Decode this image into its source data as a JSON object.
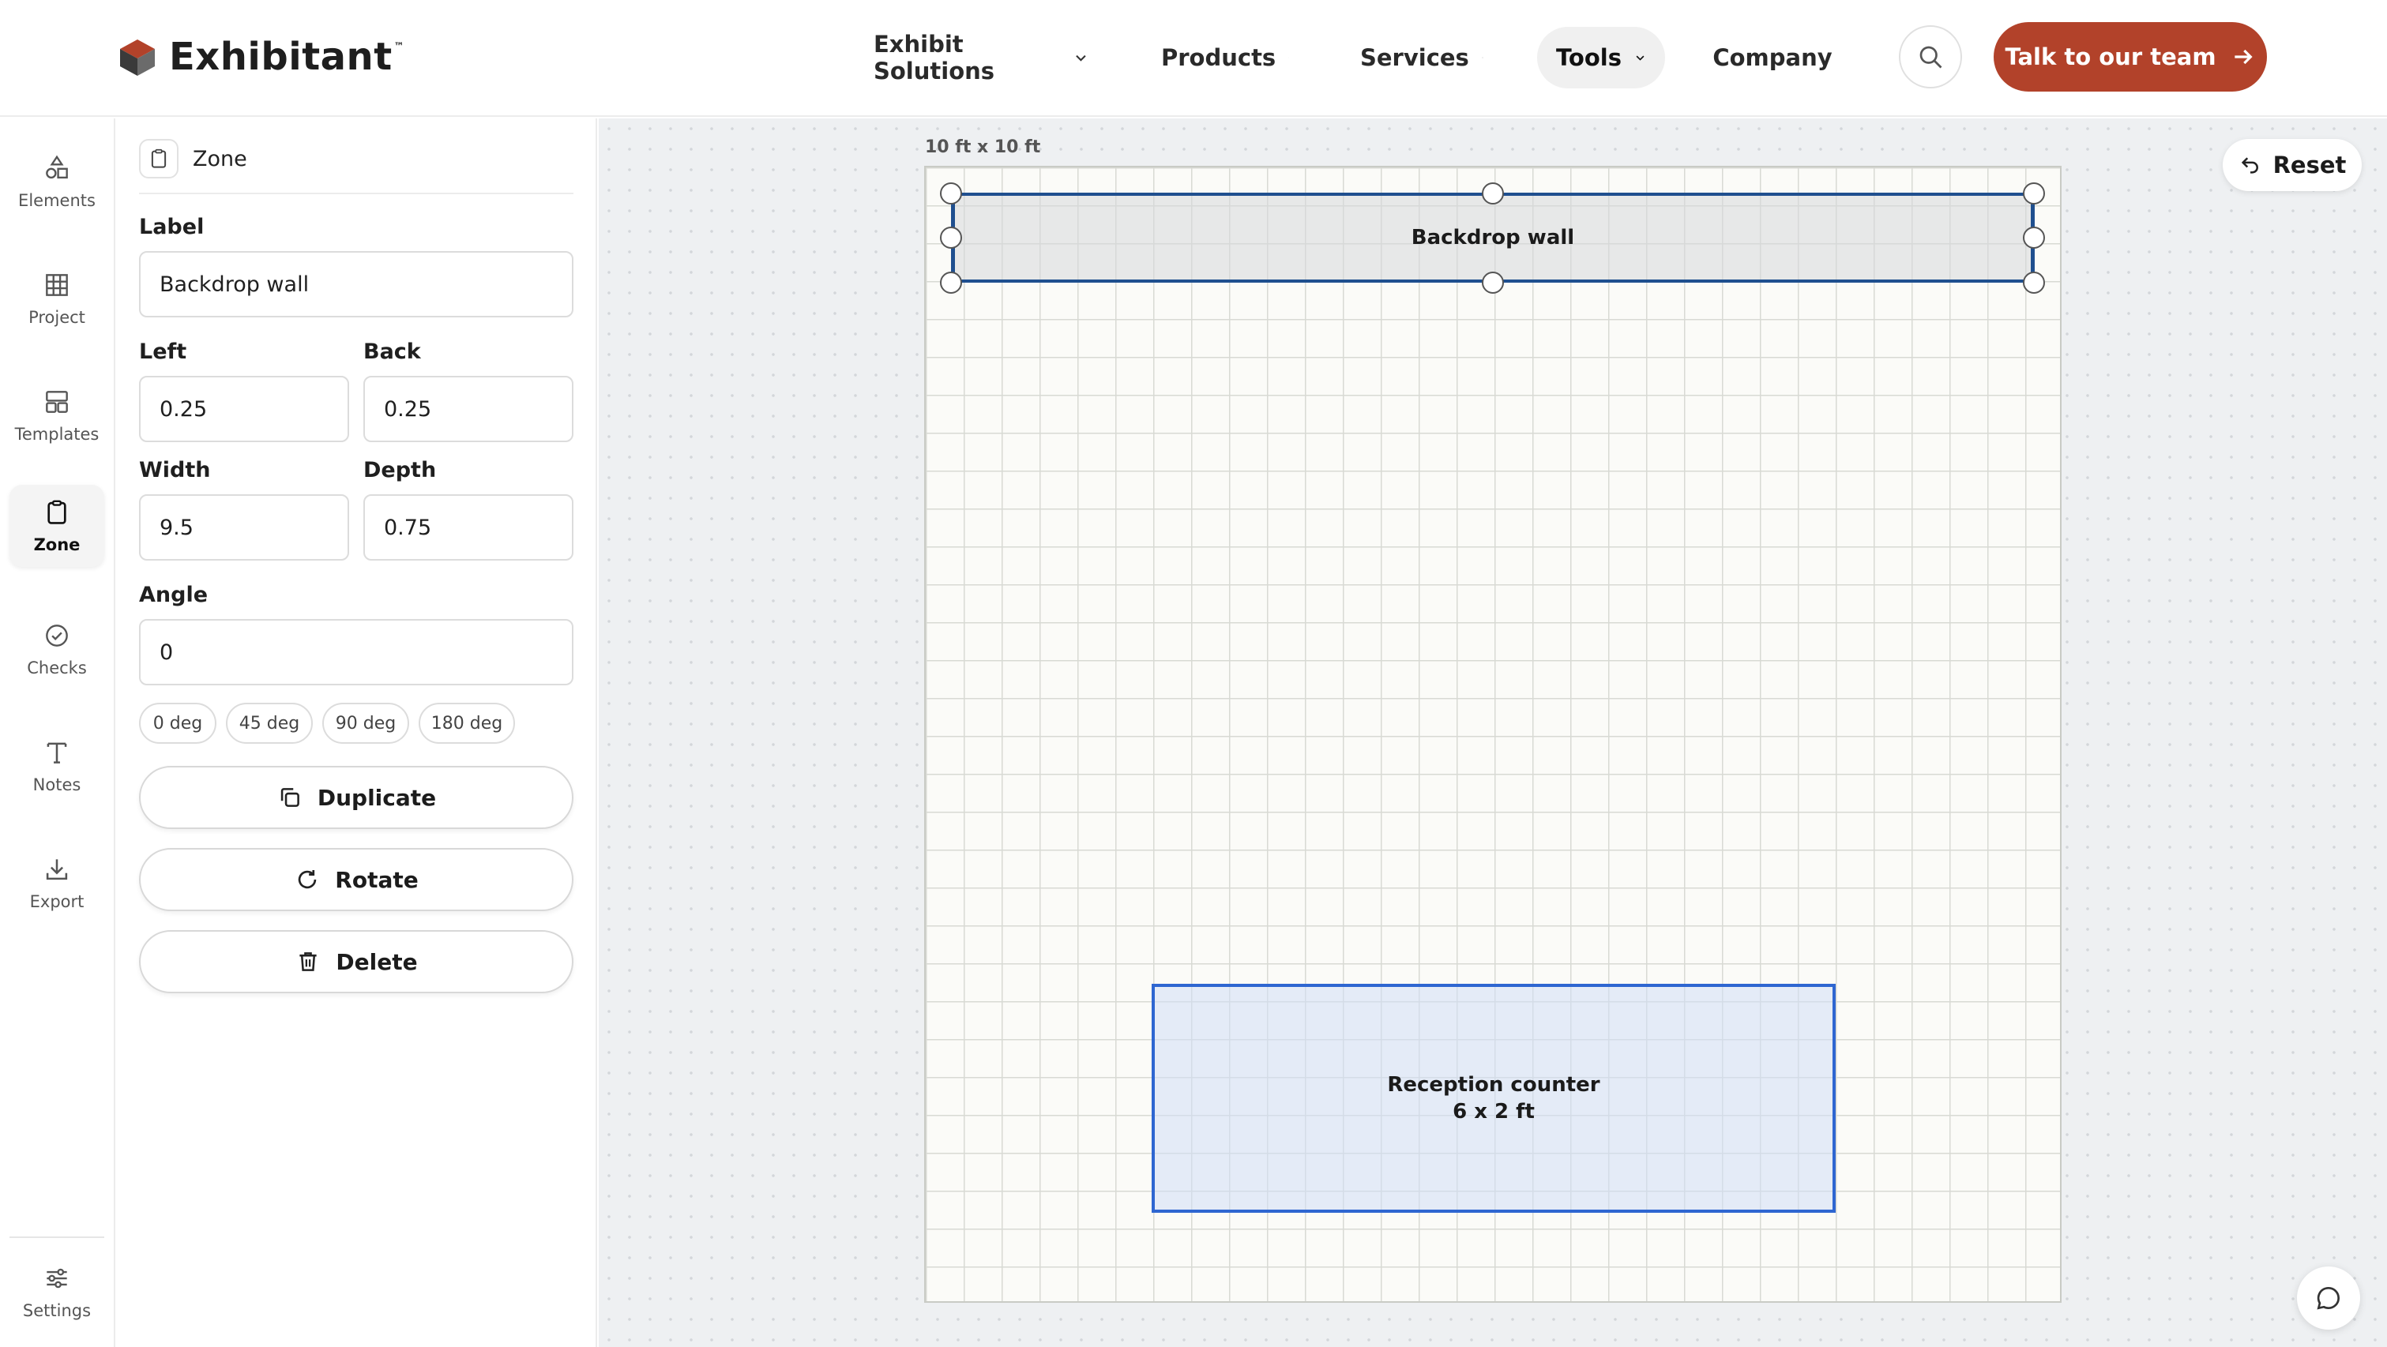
{
  "header": {
    "brand": "Exhibitant",
    "brand_tm": "™",
    "nav": [
      {
        "label": "Exhibit Solutions"
      },
      {
        "label": "Products"
      },
      {
        "label": "Services"
      },
      {
        "label": "Tools",
        "active": true
      },
      {
        "label": "Company"
      }
    ],
    "cta_label": "Talk to our team",
    "accent_color": "#b2422a"
  },
  "rail": {
    "items": [
      {
        "label": "Elements",
        "icon": "shapes-icon"
      },
      {
        "label": "Project",
        "icon": "grid-icon"
      },
      {
        "label": "Templates",
        "icon": "layout-icon"
      },
      {
        "label": "Zone",
        "icon": "clipboard-icon",
        "active": true
      },
      {
        "label": "Checks",
        "icon": "check-circle-icon"
      },
      {
        "label": "Notes",
        "icon": "text-icon"
      },
      {
        "label": "Export",
        "icon": "download-icon"
      }
    ],
    "settings_label": "Settings"
  },
  "panel": {
    "title": "Zone",
    "label_field": {
      "label": "Label",
      "value": "Backdrop wall"
    },
    "left_field": {
      "label": "Left",
      "value": "0.25"
    },
    "back_field": {
      "label": "Back",
      "value": "0.25"
    },
    "width_field": {
      "label": "Width",
      "value": "9.5"
    },
    "depth_field": {
      "label": "Depth",
      "value": "0.75"
    },
    "angle_field": {
      "label": "Angle",
      "value": "0"
    },
    "angle_presets": [
      "0 deg",
      "45 deg",
      "90 deg",
      "180 deg"
    ],
    "actions": {
      "duplicate": "Duplicate",
      "rotate": "Rotate",
      "delete": "Delete"
    }
  },
  "canvas": {
    "booth_caption": "10 ft x 10 ft",
    "reset_label": "Reset",
    "zones": {
      "backdrop": {
        "label": "Backdrop wall"
      },
      "counter": {
        "label": "Reception counter",
        "size": "6 x 2 ft"
      }
    },
    "selection_color": "#1f4f8f",
    "counter_color": "#2e66d1"
  }
}
